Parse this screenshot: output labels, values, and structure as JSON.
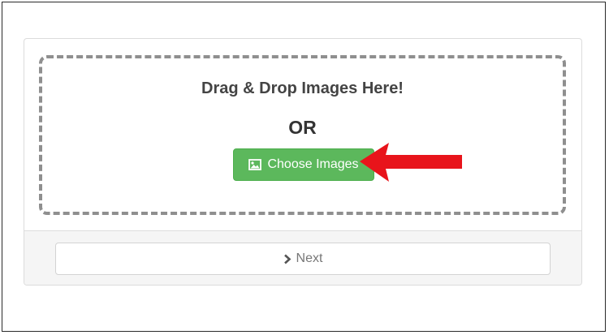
{
  "dropzone": {
    "title": "Drag & Drop Images Here!",
    "or_label": "OR"
  },
  "choose_button": {
    "label": "Choose Images",
    "icon": "picture-icon",
    "color": "#5cb85c"
  },
  "next_button": {
    "label": "Next",
    "icon": "chevron-right-icon"
  },
  "annotation": {
    "arrow_color": "#e8141b"
  }
}
